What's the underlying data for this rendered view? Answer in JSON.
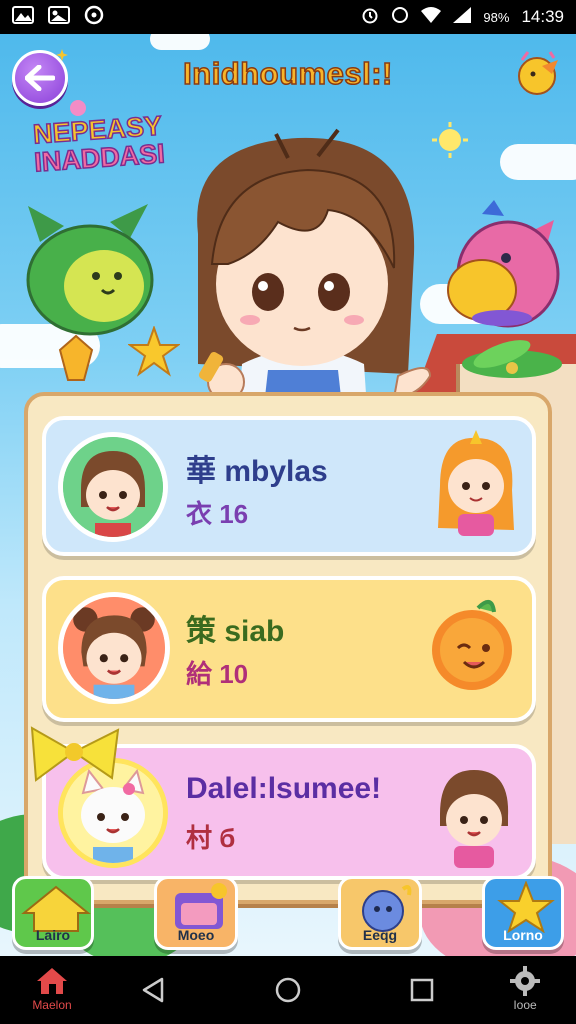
{
  "status_bar": {
    "battery_pct": "98%",
    "time": "14:39"
  },
  "header": {
    "title": "Inidhoumesl:!",
    "logo_line1": "NEPEASY",
    "logo_line2": "INADDASI"
  },
  "cards": [
    {
      "title": "華 mbylas",
      "score": "衣 16",
      "color": "#cfe7fa",
      "title_color": "#2e3e8c",
      "score_color": "#7a3fb0"
    },
    {
      "title": "策 siab",
      "score": "給 10",
      "color": "#fde08a",
      "title_color": "#3a6b1f",
      "score_color": "#b02f79"
    },
    {
      "title": "Dalel:lsumee!",
      "score": "村 б",
      "color": "#f7c0ec",
      "title_color": "#5b2ea3",
      "score_color": "#b02f40"
    }
  ],
  "bottom_buttons": [
    {
      "label": "Lairo",
      "icon": "house-icon",
      "color": "#5fc84b"
    },
    {
      "label": "Moeo",
      "icon": "shop-icon",
      "color": "#f8b467"
    },
    {
      "label": "Eeqg",
      "icon": "bunny-icon",
      "color": "#f7c76a"
    },
    {
      "label": "Lorno",
      "icon": "star-icon",
      "color": "#3d9ee8"
    }
  ],
  "nav": {
    "home_label": "Maelon",
    "settings_label": "Iooe"
  },
  "colors": {
    "accent": "#8a3fd9",
    "title": "#f7b52b"
  }
}
